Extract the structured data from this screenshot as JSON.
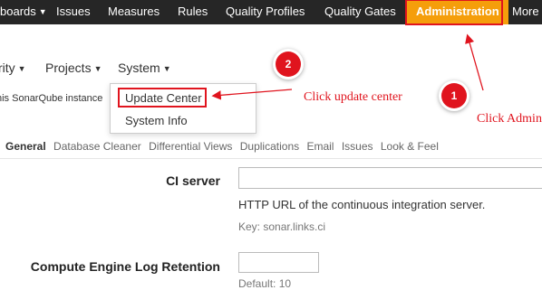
{
  "topnav": {
    "dashboards": "boards",
    "issues": "Issues",
    "measures": "Measures",
    "rules": "Rules",
    "quality_profiles": "Quality Profiles",
    "quality_gates": "Quality Gates",
    "administration": "Administration",
    "more": "More"
  },
  "subnav": {
    "security": "rity",
    "projects": "Projects",
    "system": "System"
  },
  "dropdown": {
    "update_center": "Update Center",
    "system_info": "System Info"
  },
  "info_text": "his SonarQube instance",
  "tabs": [
    "General",
    "Database Cleaner",
    "Differential Views",
    "Duplications",
    "Email",
    "Issues",
    "Look & Feel"
  ],
  "settings": {
    "ci_server": {
      "label": "CI server",
      "value": "",
      "description": "HTTP URL of the continuous integration server.",
      "key": "Key: sonar.links.ci"
    },
    "ce_log_retention": {
      "label": "Compute Engine Log Retention",
      "value": "",
      "default": "Default: 10"
    }
  },
  "annotations": {
    "step1_number": "1",
    "step1_text": "Click Admin",
    "step2_number": "2",
    "step2_text": "Click update center"
  },
  "colors": {
    "topbar": "#262626",
    "admin_active": "#f59e0b",
    "annotation_red": "#e0141e"
  }
}
